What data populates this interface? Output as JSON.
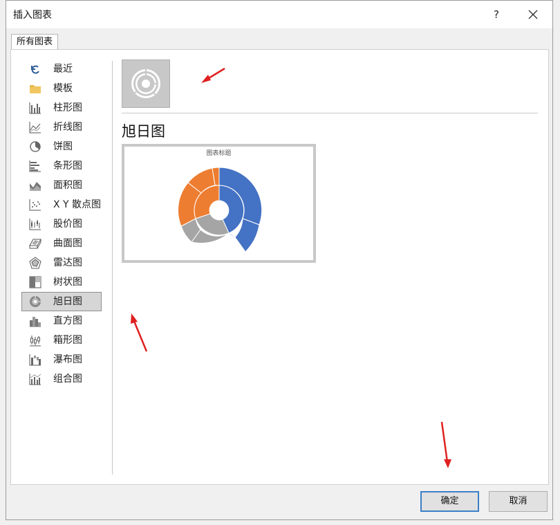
{
  "dialog": {
    "title": "插入图表",
    "help_label": "?",
    "close_icon": "close-icon"
  },
  "tabs": [
    {
      "label": "所有图表",
      "active": true
    }
  ],
  "sidebar": {
    "items": [
      {
        "label": "最近",
        "icon": "recent-icon"
      },
      {
        "label": "模板",
        "icon": "folder-icon"
      },
      {
        "label": "柱形图",
        "icon": "column-chart-icon"
      },
      {
        "label": "折线图",
        "icon": "line-chart-icon"
      },
      {
        "label": "饼图",
        "icon": "pie-chart-icon"
      },
      {
        "label": "条形图",
        "icon": "bar-chart-icon"
      },
      {
        "label": "面积图",
        "icon": "area-chart-icon"
      },
      {
        "label": "X Y 散点图",
        "icon": "scatter-chart-icon"
      },
      {
        "label": "股价图",
        "icon": "stock-chart-icon"
      },
      {
        "label": "曲面图",
        "icon": "surface-chart-icon"
      },
      {
        "label": "雷达图",
        "icon": "radar-chart-icon"
      },
      {
        "label": "树状图",
        "icon": "treemap-chart-icon"
      },
      {
        "label": "旭日图",
        "icon": "sunburst-chart-icon",
        "selected": true
      },
      {
        "label": "直方图",
        "icon": "histogram-chart-icon"
      },
      {
        "label": "箱形图",
        "icon": "box-chart-icon"
      },
      {
        "label": "瀑布图",
        "icon": "waterfall-chart-icon"
      },
      {
        "label": "组合图",
        "icon": "combo-chart-icon"
      }
    ]
  },
  "main": {
    "subtype_icon": "sunburst-thumbnail-icon",
    "chart_name": "旭日图",
    "preview_title": "图表标题"
  },
  "buttons": {
    "ok": "确定",
    "cancel": "取消"
  },
  "colors": {
    "blue": "#4472c4",
    "orange": "#ed7d31",
    "gray": "#a5a5a5",
    "selection": "#d6d6d6",
    "annotation": "#e02020"
  }
}
